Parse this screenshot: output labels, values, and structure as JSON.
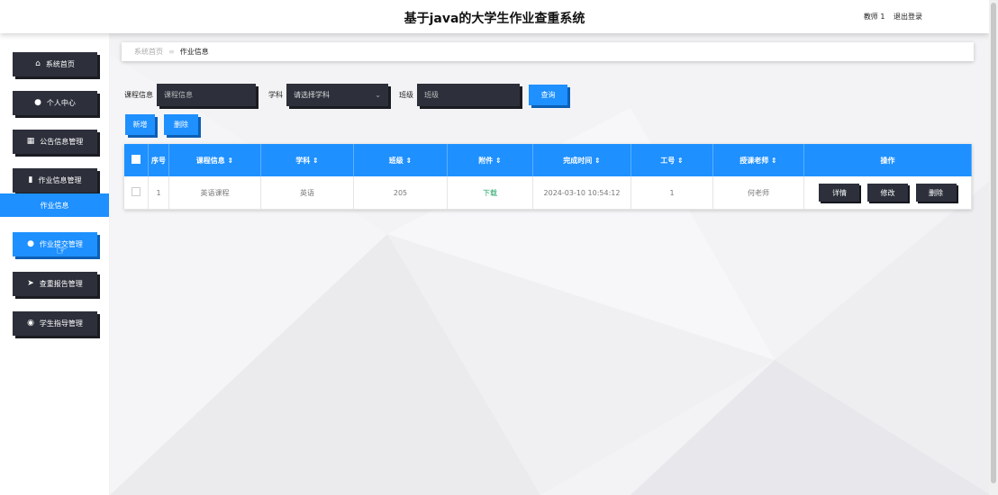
{
  "header": {
    "title": "基于java的大学生作业查重系统",
    "user": "教师 1",
    "logout": "退出登录"
  },
  "sidebar": {
    "items": [
      {
        "label": "系统首页",
        "icon": "home-icon"
      },
      {
        "label": "个人中心",
        "icon": "user-icon"
      },
      {
        "label": "公告信息管理",
        "icon": "grid-icon"
      },
      {
        "label": "作业信息管理",
        "icon": "bar-chart-icon"
      },
      {
        "label": "作业提交管理",
        "icon": "user-icon"
      },
      {
        "label": "查重报告管理",
        "icon": "send-icon"
      },
      {
        "label": "学生指导管理",
        "icon": "bulb-icon"
      }
    ],
    "submenu": "作业信息"
  },
  "breadcrumb": {
    "home": "系统首页",
    "separator": "≡",
    "current": "作业信息"
  },
  "search": {
    "course_label": "课程信息",
    "course_placeholder": "课程信息",
    "subject_label": "学科",
    "subject_placeholder": "请选择学科",
    "class_label": "班级",
    "class_placeholder": "班级",
    "query_button": "查询"
  },
  "actions": {
    "add": "新增",
    "delete": "删除"
  },
  "table": {
    "headers": [
      "序号",
      "课程信息 ⇕",
      "学科 ⇕",
      "班级 ⇕",
      "附件 ⇕",
      "完成时间 ⇕",
      "工号 ⇕",
      "授课老师 ⇕",
      "操作"
    ],
    "rows": [
      {
        "index": "1",
        "course": "英语课程",
        "subject": "英语",
        "class": "205",
        "attachment": "下载",
        "time": "2024-03-10 10:54:12",
        "job_no": "1",
        "teacher": "何老师"
      }
    ],
    "row_buttons": {
      "detail": "详情",
      "edit": "修改",
      "delete": "删除"
    }
  },
  "colors": {
    "primary": "#1e90ff",
    "dark": "#2d303b",
    "download": "#1aa260"
  }
}
